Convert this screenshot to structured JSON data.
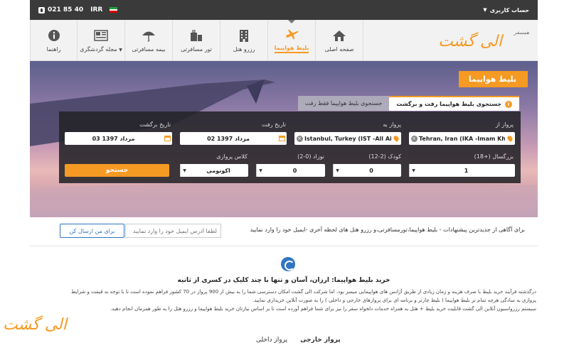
{
  "topbar": {
    "phone": "021 85 40",
    "currency": "IRR",
    "account_label": "حساب کاربری",
    "flag_colors": [
      "#239f40",
      "#ffffff",
      "#da0000"
    ]
  },
  "nav": {
    "items": [
      {
        "label": "راهنما",
        "icon": "info-icon"
      },
      {
        "label": "مجله گردشگری",
        "icon": "magazine-icon"
      },
      {
        "label": "بیمه مسافرتی",
        "icon": "umbrella-icon"
      },
      {
        "label": "تور مسافرتی",
        "icon": "luggage-icon"
      },
      {
        "label": "رزرو هتل",
        "icon": "hotel-icon"
      },
      {
        "label": "بلیط هواپیما",
        "icon": "airplane-icon"
      },
      {
        "label": "صفحه اصلی",
        "icon": "home-icon"
      }
    ],
    "active_index": 5,
    "logo": "الی گشت",
    "logo_tagline": "همسفر"
  },
  "hero": {
    "title": "بلیط هواپیما",
    "tabs": [
      {
        "label": "جستجوی بلیط هواپیما رفت و برگشت"
      },
      {
        "label": "جستجوی بلیط هواپیما فقط رفت"
      }
    ],
    "form": {
      "from_label": "پرواز از",
      "from_value": "Tehran, Iran (IKA -Imam Khomei",
      "to_label": "پرواز به",
      "to_value": "Istanbul, Turkey (IST -All Airport",
      "depart_label": "تاریخ رفت",
      "depart_value": "02 مرداد 1397",
      "return_label": "تاریخ برگشت",
      "return_value": "03 مرداد 1397",
      "adult_label": "بزرگسال (+18)",
      "adult_value": "1",
      "child_label": "کودک (2-12)",
      "child_value": "0",
      "infant_label": "نوزاد (0-2)",
      "infant_value": "0",
      "class_label": "کلاس پروازی",
      "class_value": "اکونومی",
      "search_button": "جستجو"
    }
  },
  "newsletter": {
    "text": "برای آگاهی از جدیدترین پیشنهادات - بلیط هواپیما،تورمسافرتی،و رزرو هتل های لحظه آخری -ایمیل خود را وارد نمایید",
    "placeholder": "لطفا آدرس ایمیل خود را وارد نمایید",
    "button": "برای من ارسال کن"
  },
  "article": {
    "title": "خرید بلیط هواپیما: ارزان، آسان و تنها با چند کلیک در کسری از ثانیه",
    "p1": "درگذشته فرآیند خرید بلیط با صرف هزینه و زمان زیادی از طریق آژانس های هواپیمایی میسر بود، اما شرکت الی گشت امکان دسترسی شما را به بیش از 900 پرواز در 70 کشور فراهم نموده است تا با توجه به قیمت و شرایط",
    "p2": "پروازی به سادگی هرچه تمام تر بلیط هواپیما ( بلیط چارتر و برنامه ای برای پروازهای خارجی و داخلی ) را به صورت آنلاین خریداری نمایید.",
    "p3": "سیستم رزرواسیون آنلاین الی گشت قابلیت خرید بلیط + هتل به همراه خدمات دلخواه سفر را نیز برای شما فراهم آورده است تا بر اساس نیازتان خرید بلیط هواپیما و رزرو هتل را به طور همزمان انجام دهید."
  },
  "bottom_tabs": [
    "پرواز خارجی",
    "پرواز داخلی"
  ],
  "footer_logo": "الی گشت",
  "colors": {
    "accent": "#f59a23",
    "link": "#2f75c4",
    "dark": "#3a3a3a"
  }
}
